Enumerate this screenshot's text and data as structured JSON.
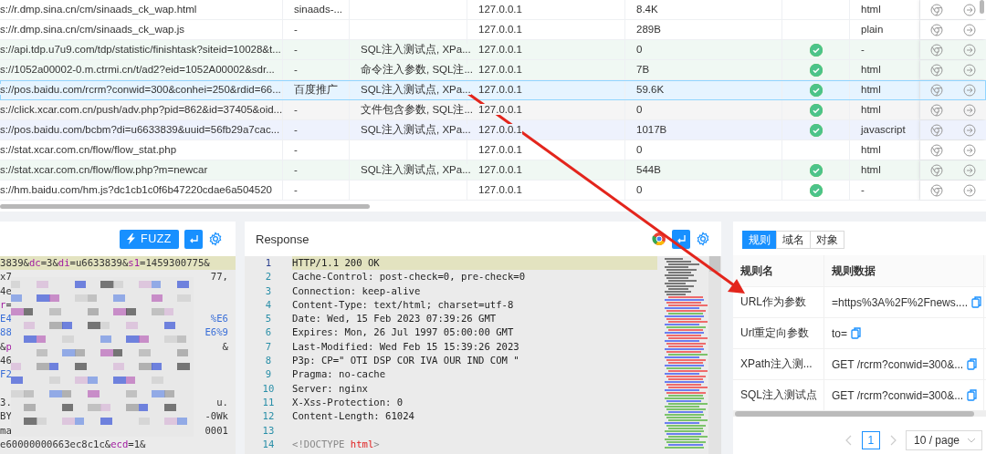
{
  "request_table": {
    "rows": [
      {
        "url": "s://r.dmp.sina.cn/cm/sinaads_ck_wap.html",
        "source": "sinaads-...",
        "ip": "127.0.0.1",
        "size": "8.4K",
        "checked": false,
        "type": "html",
        "selected": false,
        "color": "#ffffff"
      },
      {
        "url": "s://r.dmp.sina.cn/cm/sinaads_ck_wap.js",
        "source": "-",
        "ip": "127.0.0.1",
        "size": "289B",
        "checked": false,
        "type": "plain",
        "selected": false,
        "color": "#ffffff"
      },
      {
        "url": "s://api.tdp.u7u9.com/tdp/statistic/finishtask?siteid=10028&t...",
        "source": "-",
        "tags": "SQL注入测试点, XPa...",
        "ip": "127.0.0.1",
        "size": "0",
        "checked": true,
        "type": "-",
        "selected": false,
        "color": "#f0f8f3"
      },
      {
        "url": "s://1052a00002-0.m.ctrmi.cn/t/ad2?eid=1052A00002&sdr...",
        "source": "-",
        "tags": "命令注入参数, SQL注...",
        "ip": "127.0.0.1",
        "size": "7B",
        "checked": true,
        "type": "html",
        "selected": false,
        "color": "#f0f8f3"
      },
      {
        "url": "s://pos.baidu.com/rcrm?conwid=300&conhei=250&rdid=66...",
        "source": "百度推广",
        "tags": "SQL注入测试点, XPa...",
        "ip": "127.0.0.1",
        "size": "59.6K",
        "checked": true,
        "type": "html",
        "selected": true,
        "color": "#e6f4ff"
      },
      {
        "url": "s://click.xcar.com.cn/push/adv.php?pid=862&id=37405&oid...",
        "source": "-",
        "tags": "文件包含参数, SQL注...",
        "ip": "127.0.0.1",
        "size": "0",
        "checked": true,
        "type": "html",
        "selected": false,
        "color": "#f5f5f5"
      },
      {
        "url": "s://pos.baidu.com/bcbm?di=u6633839&uuid=56fb29a7cac...",
        "source": "-",
        "tags": "SQL注入测试点, XPa...",
        "ip": "127.0.0.1",
        "size": "1017B",
        "checked": true,
        "type": "javascript",
        "selected": false,
        "color": "#eef2fd"
      },
      {
        "url": "s://stat.xcar.com.cn/flow/flow_stat.php",
        "source": "-",
        "ip": "127.0.0.1",
        "size": "0",
        "checked": false,
        "type": "html",
        "selected": false,
        "color": "#ffffff"
      },
      {
        "url": "s://stat.xcar.com.cn/flow/flow.php?m=newcar",
        "source": "-",
        "tags": "SQL注入测试点, XPa...",
        "ip": "127.0.0.1",
        "size": "544B",
        "checked": true,
        "type": "html",
        "selected": false,
        "color": "#f0f8f3"
      },
      {
        "url": "s://hm.baidu.com/hm.js?dc1cb1c0f6b47220cdae6a504520",
        "source": "-",
        "ip": "127.0.0.1",
        "size": "0",
        "checked": true,
        "type": "-",
        "selected": false,
        "color": "#ffffff"
      }
    ]
  },
  "request_editor": {
    "fuzz_button": "FUZZ",
    "lines": [
      {
        "start": [
          {
            "text": "3839&",
            "kind": "text"
          },
          {
            "text": "dc",
            "kind": "key"
          },
          {
            "text": "=3&",
            "kind": "text"
          },
          {
            "text": "di",
            "kind": "key"
          },
          {
            "text": "=u6633839&",
            "kind": "text"
          },
          {
            "text": "s1",
            "kind": "key"
          },
          {
            "text": "=1459300775&",
            "kind": "text"
          }
        ],
        "highlighted": true
      },
      {
        "start": [
          {
            "text": "x7",
            "kind": "text"
          }
        ],
        "end": [
          {
            "text": "77,",
            "kind": "text"
          }
        ],
        "highlighted": false
      },
      {
        "start": [
          {
            "text": "4e",
            "kind": "text"
          }
        ],
        "highlighted": false
      },
      {
        "start": [
          {
            "text": "r",
            "kind": "key"
          },
          {
            "text": "=",
            "kind": "text"
          }
        ],
        "highlighted": false
      },
      {
        "start": [
          {
            "text": "E4",
            "kind": "value"
          }
        ],
        "end": [
          {
            "text": "%E6",
            "kind": "value"
          }
        ],
        "highlighted": false
      },
      {
        "start": [
          {
            "text": "88",
            "kind": "value"
          }
        ],
        "end": [
          {
            "text": "E6%9",
            "kind": "value"
          }
        ],
        "highlighted": false
      },
      {
        "start": [
          {
            "text": "&",
            "kind": "text"
          },
          {
            "text": "p",
            "kind": "key"
          }
        ],
        "end": [
          {
            "text": "&",
            "kind": "text"
          }
        ],
        "highlighted": false
      },
      {
        "start": [
          {
            "text": "46",
            "kind": "text"
          }
        ],
        "highlighted": false
      },
      {
        "start": [
          {
            "text": "F2",
            "kind": "value"
          }
        ],
        "highlighted": false
      },
      {
        "highlighted": false
      },
      {
        "start": [
          {
            "text": "3.",
            "kind": "text"
          }
        ],
        "end": [
          {
            "text": "u.",
            "kind": "text"
          }
        ],
        "highlighted": false
      },
      {
        "start": [
          {
            "text": "BY",
            "kind": "text"
          }
        ],
        "end": [
          {
            "text": "-0Wk",
            "kind": "text"
          }
        ],
        "highlighted": false
      },
      {
        "start": [
          {
            "text": "ma",
            "kind": "text"
          }
        ],
        "end": [
          {
            "text": "0001",
            "kind": "text"
          }
        ],
        "highlighted": false
      },
      {
        "start": [
          {
            "text": "e60000000663ec8c1c&",
            "kind": "text"
          },
          {
            "text": "ecd",
            "kind": "key"
          },
          {
            "text": "=1&",
            "kind": "text"
          }
        ],
        "highlighted": false
      }
    ]
  },
  "response": {
    "title": "Response",
    "lines": [
      {
        "number": "1",
        "text": "HTTP/1.1 200 OK",
        "highlighted": true
      },
      {
        "number": "2",
        "text": "Cache-Control: post-check=0, pre-check=0",
        "highlighted": false
      },
      {
        "number": "3",
        "text": "Connection: keep-alive",
        "highlighted": false
      },
      {
        "number": "4",
        "text": "Content-Type: text/html; charset=utf-8",
        "highlighted": false
      },
      {
        "number": "5",
        "text": "Date: Wed, 15 Feb 2023 07:39:26 GMT",
        "highlighted": false
      },
      {
        "number": "6",
        "text": "Expires: Mon, 26 Jul 1997 05:00:00 GMT",
        "highlighted": false
      },
      {
        "number": "7",
        "text": "Last-Modified: Wed Feb 15 15:39:26 2023",
        "highlighted": false
      },
      {
        "number": "8",
        "text": "P3p: CP=\" OTI DSP COR IVA OUR IND COM \"",
        "highlighted": false
      },
      {
        "number": "9",
        "text": "Pragma: no-cache",
        "highlighted": false
      },
      {
        "number": "10",
        "text": "Server: nginx",
        "highlighted": false
      },
      {
        "number": "11",
        "text": "X-Xss-Protection: 0",
        "highlighted": false
      },
      {
        "number": "12",
        "text": "Content-Length: 61024",
        "highlighted": false
      },
      {
        "number": "13",
        "highlighted": false
      },
      {
        "number": "14",
        "segments": [
          {
            "text": "<!DOCTYPE ",
            "kind": "punct"
          },
          {
            "text": "html",
            "kind": "tag"
          },
          {
            "text": ">",
            "kind": "punct"
          }
        ],
        "highlighted": false
      }
    ]
  },
  "rules": {
    "tabs": [
      {
        "label": "规则",
        "selected": true
      },
      {
        "label": "域名",
        "selected": false
      },
      {
        "label": "对象",
        "selected": false
      }
    ],
    "columns": [
      "规则名",
      "规则数据"
    ],
    "rows": [
      {
        "name": "URL作为参数",
        "data": "=https%3A%2F%2Fnews...."
      },
      {
        "name": "Url重定向参数",
        "data": "to="
      },
      {
        "name": "XPath注入测...",
        "data": "GET /rcrm?conwid=300&..."
      },
      {
        "name": "SQL注入测试点",
        "data": "GET /rcrm?conwid=300&..."
      }
    ],
    "pagination": {
      "pages": [
        {
          "label": "1",
          "selected": true
        }
      ],
      "page_size": "10 / page"
    }
  }
}
